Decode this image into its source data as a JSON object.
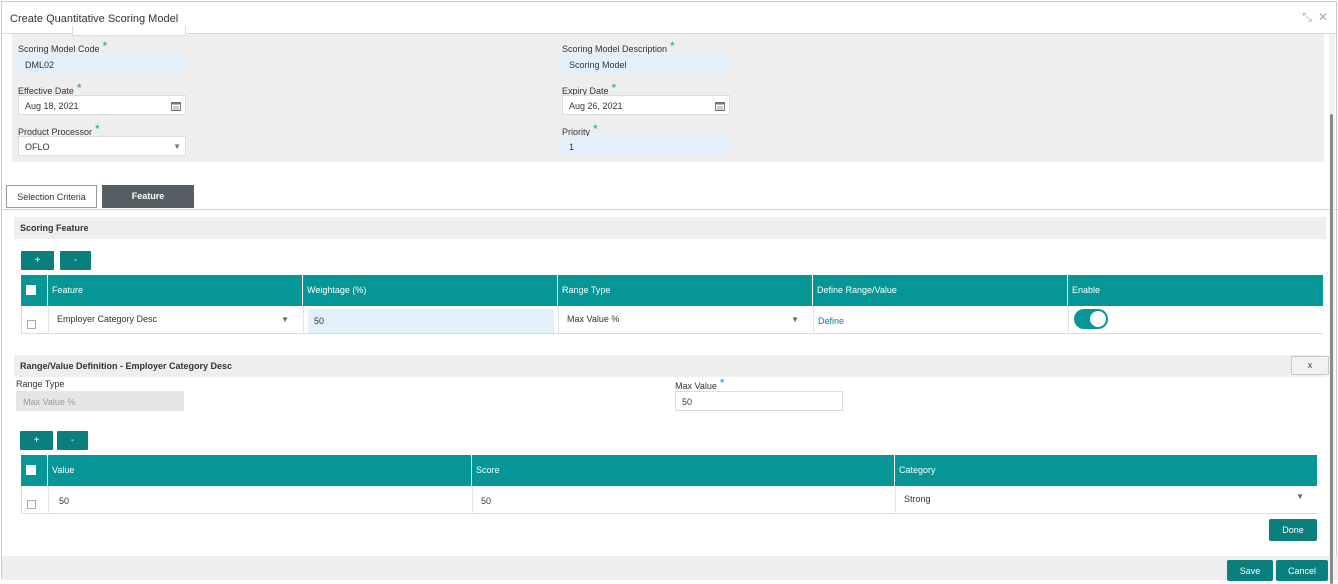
{
  "window": {
    "title": "Create Quantitative Scoring Model",
    "restore_icon": "⤡",
    "close_icon": "✕"
  },
  "header": {
    "code_label": "Scoring Model Code",
    "code_value": "DML02",
    "desc_label": "Scoring Model Description",
    "desc_value": "Scoring Model",
    "effective_label": "Effective Date",
    "effective_value": "Aug 18, 2021",
    "expiry_label": "Expiry Date",
    "expiry_value": "Aug 26, 2021",
    "processor_label": "Product Processor",
    "processor_value": "OFLO",
    "priority_label": "Priority",
    "priority_value": "1",
    "required_mark": "*"
  },
  "tabs": [
    {
      "label": "Selection Criteria",
      "active": false
    },
    {
      "label": "Feature",
      "active": true
    }
  ],
  "scoring_feature": {
    "title": "Scoring Feature",
    "add_label": "+",
    "remove_label": "-",
    "columns": [
      "Feature",
      "Weightage (%)",
      "Range Type",
      "Define Range/Value",
      "Enable"
    ],
    "rows": [
      {
        "feature": "Employer Category Desc",
        "weightage": "50",
        "range_type": "Max Value %",
        "define": "Define",
        "enabled": true
      }
    ]
  },
  "range_definition": {
    "title": "Range/Value Definition - Employer Category Desc",
    "close_label": "x",
    "range_type_label": "Range Type",
    "range_type_value": "Max Value %",
    "max_value_label": "Max Value",
    "max_value_value": "50",
    "add_label": "+",
    "remove_label": "-",
    "columns": [
      "Value",
      "Score",
      "Category"
    ],
    "rows": [
      {
        "value": "50",
        "score": "50",
        "category": "Strong"
      }
    ],
    "done_label": "Done"
  },
  "footer": {
    "save_label": "Save",
    "cancel_label": "Cancel"
  },
  "icons": {
    "calendar": "calendar-icon",
    "dropdown": "chevron-down-icon"
  },
  "colors": {
    "accent": "#079696",
    "button": "#0a7f7e",
    "tab_active": "#555f63"
  }
}
